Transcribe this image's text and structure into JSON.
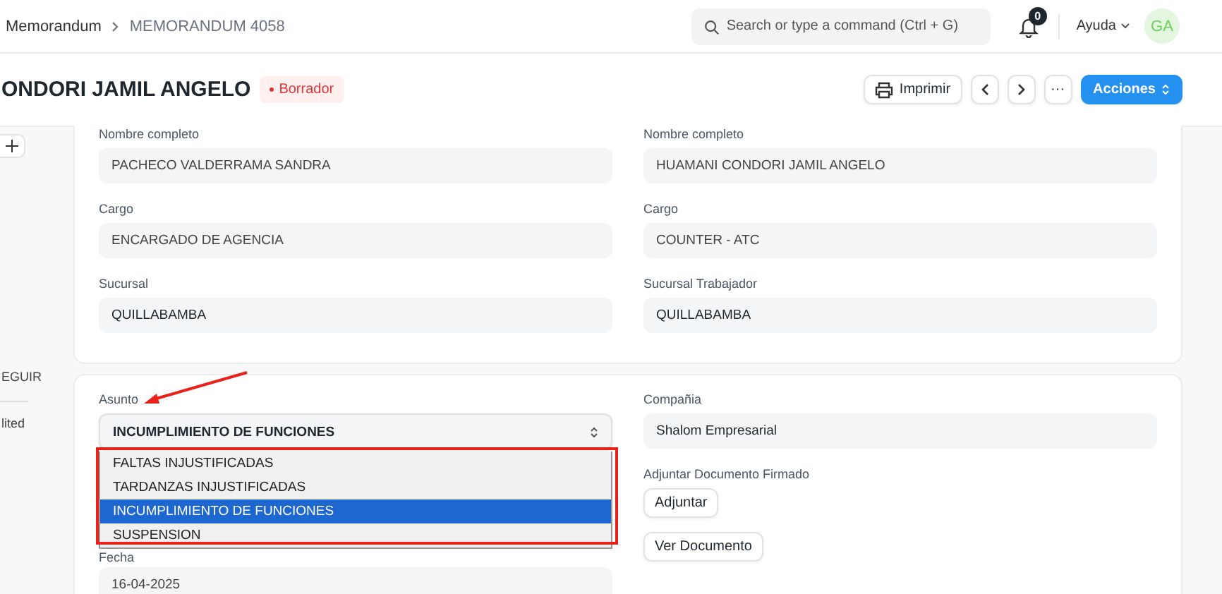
{
  "navbar": {
    "breadcrumbs": [
      "Memorandum",
      "MEMORANDUM 4058"
    ],
    "search": {
      "placeholder": "Search or type a command (Ctrl + G)"
    },
    "notifications": "0",
    "help": "Ayuda",
    "avatar": "GA"
  },
  "header": {
    "title": "ONDORI JAMIL ANGELO",
    "status": "Borrador",
    "buttons": {
      "print": "Imprimir",
      "more": "···",
      "actions": "Acciones"
    }
  },
  "sidebar": {
    "items": [
      "EGUIR",
      "lited"
    ]
  },
  "card_1": {
    "columns": [
      [
        {
          "label": "Nombre completo",
          "value": "PACHECO VALDERRAMA SANDRA"
        },
        {
          "label": "Cargo",
          "value": "ENCARGADO DE AGENCIA"
        },
        {
          "label": "Sucursal",
          "value": "QUILLABAMBA"
        }
      ],
      [
        {
          "label": "Nombre completo",
          "value": "HUAMANI CONDORI JAMIL ANGELO"
        },
        {
          "label": "Cargo",
          "value": "COUNTER - ATC"
        },
        {
          "label": "Sucursal Trabajador",
          "value": "QUILLABAMBA"
        }
      ]
    ]
  },
  "card_2": {
    "asunto": {
      "label": "Asunto",
      "value": "INCUMPLIMIENTO DE FUNCIONES",
      "options": [
        {
          "label": "FALTAS INJUSTIFICADAS",
          "selected": false
        },
        {
          "label": "TARDANZAS INJUSTIFICADAS",
          "selected": false
        },
        {
          "label": "INCUMPLIMIENTO DE FUNCIONES",
          "selected": true
        },
        {
          "label": "SUSPENSION",
          "selected": false
        }
      ]
    },
    "fecha": {
      "label": "Fecha",
      "value": "16-04-2025"
    },
    "compania": {
      "label": "Compañia",
      "value": "Shalom Empresarial"
    },
    "adjuntar": {
      "label": "Adjuntar Documento Firmado",
      "button": "Adjuntar"
    },
    "ver_documento": "Ver Documento"
  }
}
